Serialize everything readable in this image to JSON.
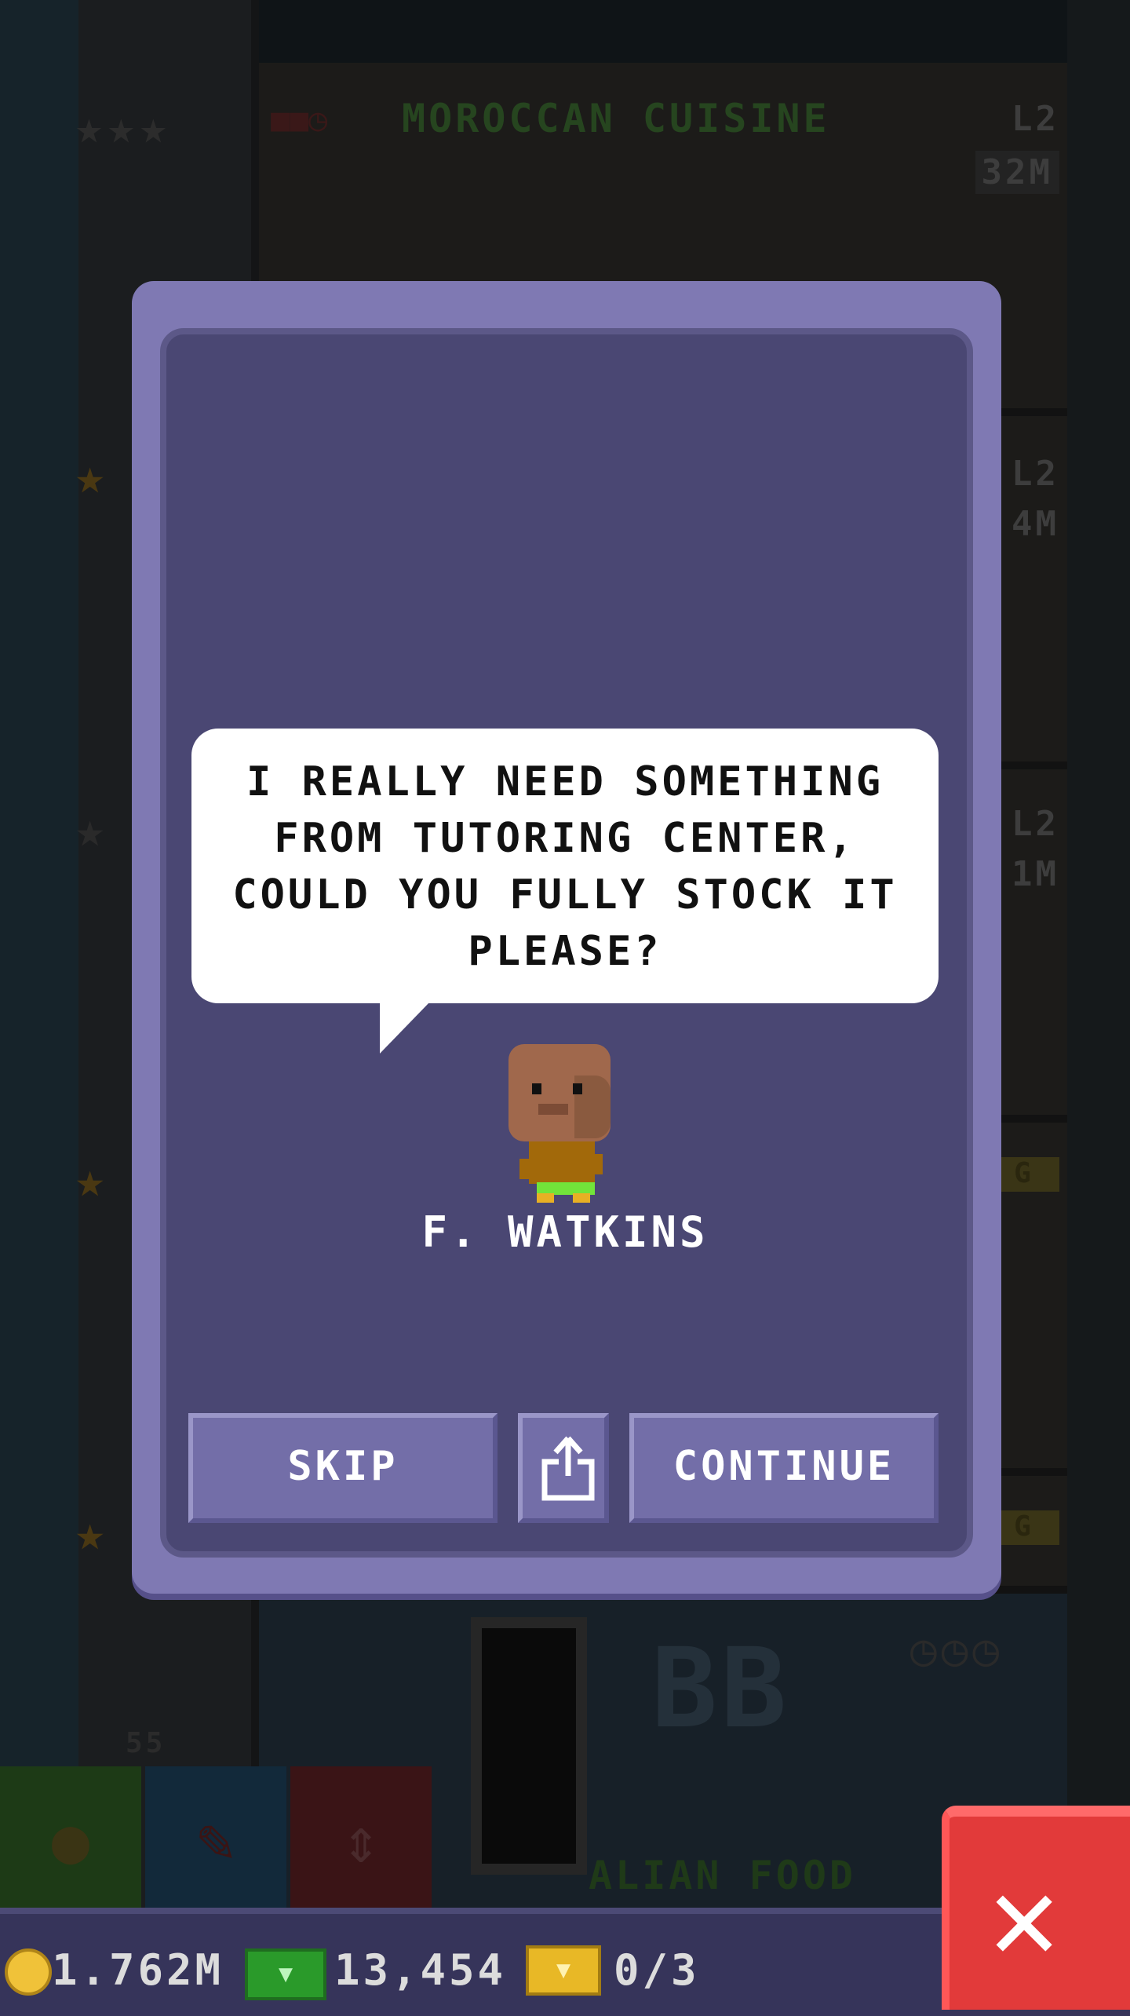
{
  "background": {
    "floor_name": "MOROCCAN CUISINE",
    "floor_level": "L2",
    "floor_money": "32M",
    "side_levels": [
      "L2",
      "4M",
      "L2",
      "1M"
    ],
    "side_tags": [
      "G",
      "G"
    ],
    "bb_sign": "BB",
    "lower_floor_name": "ALIAN FOOD",
    "lower_level": "55"
  },
  "dialog": {
    "message": "I REALLY NEED SOMETHING FROM TUTORING CENTER, COULD YOU FULLY STOCK IT PLEASE?",
    "character_name": "F. WATKINS",
    "skip_label": "SKIP",
    "continue_label": "CONTINUE",
    "share_icon": "share-icon"
  },
  "status": {
    "coins": "1.762M",
    "cash": "13,454",
    "tickets": "0/3"
  },
  "colors": {
    "dialog_frame": "#7f79b3",
    "dialog_inner": "#4a4773",
    "close_button": "#e23a3a",
    "status_bar": "#36345a"
  }
}
